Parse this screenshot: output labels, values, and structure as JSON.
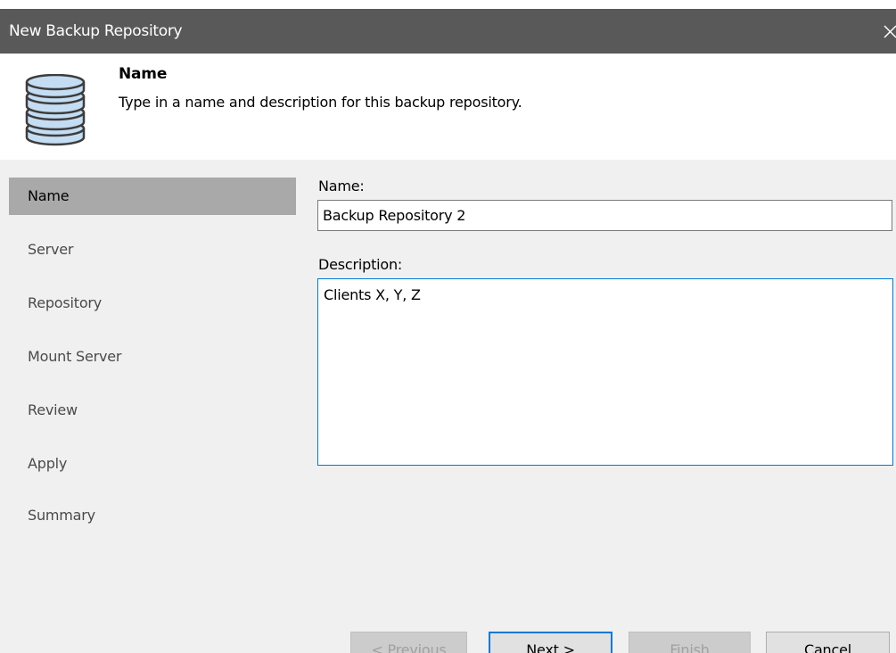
{
  "window": {
    "title": "New Backup Repository",
    "close_icon": "close-icon"
  },
  "header": {
    "icon": "database-icon",
    "title": "Name",
    "description": "Type in a name and description for this backup repository."
  },
  "sidebar": {
    "items": [
      {
        "label": "Name",
        "active": true
      },
      {
        "label": "Server",
        "active": false
      },
      {
        "label": "Repository",
        "active": false
      },
      {
        "label": "Mount Server",
        "active": false
      },
      {
        "label": "Review",
        "active": false
      },
      {
        "label": "Apply",
        "active": false
      },
      {
        "label": "Summary",
        "active": false
      }
    ]
  },
  "form": {
    "name_label": "Name:",
    "name_value": "Backup Repository 2",
    "description_label": "Description:",
    "description_value": "Clients X, Y, Z"
  },
  "buttons": {
    "previous": "< Previous",
    "next": "Next >",
    "finish": "Finish",
    "cancel": "Cancel"
  },
  "colors": {
    "titlebar": "#595959",
    "panel": "#f0f0f0",
    "active_nav": "#a9a9a9",
    "focus_border": "#0078d7",
    "icon_fill": "#c4ddf2",
    "icon_stroke": "#3d3d3d"
  }
}
